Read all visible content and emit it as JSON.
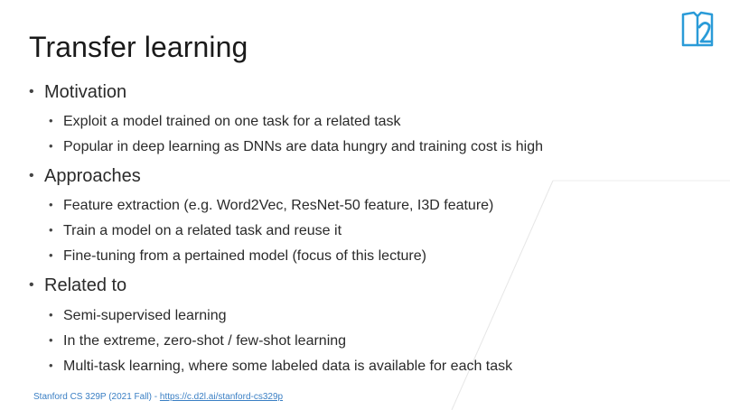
{
  "slide": {
    "title": "Transfer learning",
    "sections": [
      {
        "label": "Motivation",
        "items": [
          "Exploit a model trained on one task for a related task",
          "Popular in deep learning as DNNs are data hungry and training cost is high"
        ]
      },
      {
        "label": "Approaches",
        "items": [
          "Feature extraction (e.g. Word2Vec, ResNet-50 feature, I3D feature)",
          "Train a model on a related task and reuse it",
          "Fine-tuning from a pertained model (focus of this lecture)"
        ]
      },
      {
        "label": "Related to",
        "items": [
          "Semi-supervised learning",
          "In the extreme, zero-shot / few-shot learning",
          "Multi-task learning, where some labeled data is available for each task"
        ]
      }
    ],
    "footer": {
      "prefix": "Stanford CS 329P (2021 Fall) - ",
      "link": "https://c.d2l.ai/stanford-cs329p"
    }
  },
  "bullet_glyph": "•",
  "logo_icon": "d2l-book-logo-icon",
  "colors": {
    "accent": "#2a9bd8",
    "footer_link": "#3a7fc4"
  }
}
